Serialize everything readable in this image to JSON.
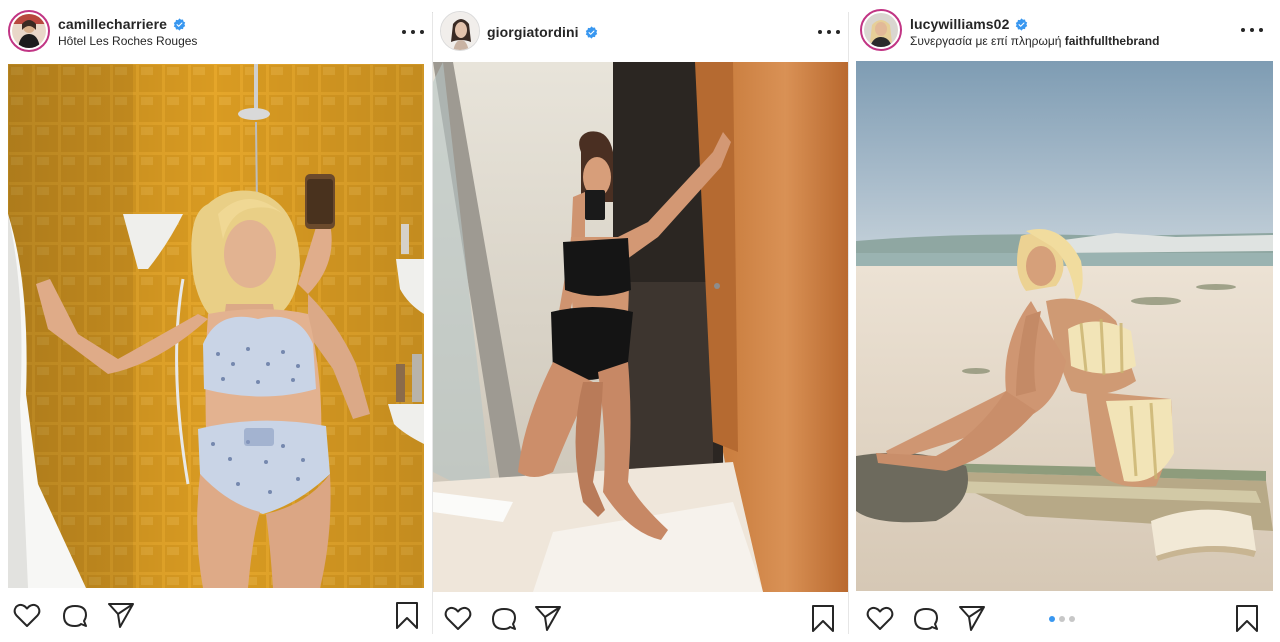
{
  "posts": [
    {
      "username": "camillecharriere",
      "subline": "Hôtel Les Roches Rouges",
      "verified": true,
      "avatar_icon": "profile-photo-woman-mirror",
      "photo_subject": "woman-in-shower-yellow-tiles",
      "carousel": null
    },
    {
      "username": "giorgiatordini",
      "subline": "",
      "verified": true,
      "avatar_icon": "profile-photo-woman-portrait",
      "photo_subject": "woman-mirror-selfie-doorway",
      "carousel": null
    },
    {
      "username": "lucywilliams02",
      "subline_prefix": "Συνεργασία με επί πληρωμή",
      "subline_brand": "faithfullthebrand",
      "verified": true,
      "avatar_icon": "profile-photo-woman-blonde",
      "photo_subject": "woman-on-beach-towel",
      "carousel": {
        "count": 3,
        "active": 1
      }
    }
  ],
  "icons": {
    "like": "heart-icon",
    "comment": "comment-bubble-icon",
    "share": "paper-plane-icon",
    "save": "bookmark-icon",
    "more": "more-options-icon",
    "verified": "verified-badge-icon"
  },
  "colors": {
    "verified_blue": "#3897f0",
    "story_ring": "#c13584",
    "text": "#262626",
    "carousel_active": "#3897f0",
    "carousel_inactive": "#c7c7c7"
  }
}
